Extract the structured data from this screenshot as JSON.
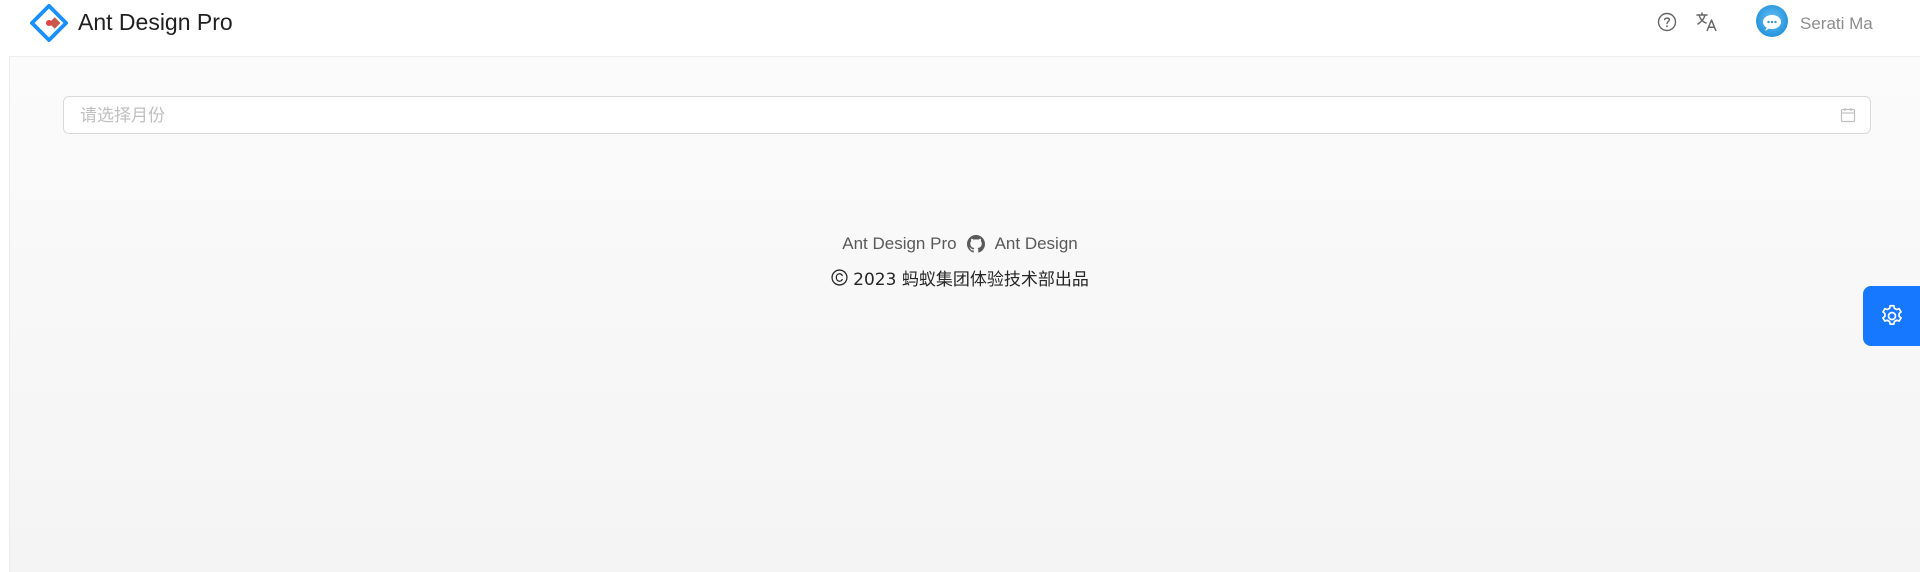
{
  "header": {
    "brand": "Ant Design Pro",
    "logo_icon": "ant-design-logo",
    "help_icon": "question-circle-icon",
    "translate_icon": "translation-icon",
    "user": {
      "name": "Serati Ma",
      "avatar_icon": "avatar-chat-icon"
    }
  },
  "month_picker": {
    "placeholder": "请选择月份",
    "value": "",
    "icon": "calendar-icon"
  },
  "footer": {
    "links": [
      {
        "label": "Ant Design Pro"
      },
      {
        "label": "Ant Design"
      }
    ],
    "github_icon": "github-icon",
    "copyright": "2023 蚂蚁集团体验技术部出品"
  },
  "settings_drawer": {
    "icon": "gear-icon",
    "color": "#1677ff"
  },
  "colors": {
    "primary": "#1677ff",
    "logo_red": "#f5222d"
  }
}
